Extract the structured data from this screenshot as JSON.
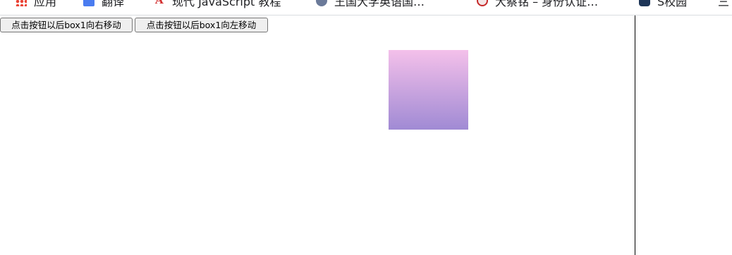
{
  "bookmarks": [
    {
      "label": "应用",
      "icon": "apps-grid-icon"
    },
    {
      "label": "翻译",
      "icon": "translate-icon"
    },
    {
      "label": "现代 JavaScript 教程",
      "icon": "javascript-tutorial-icon"
    },
    {
      "label": "王国大学英语国…",
      "icon": "university-icon"
    },
    {
      "label": "大蔡铭 – 身份认证…",
      "icon": "identity-icon"
    },
    {
      "label": "S校园",
      "icon": "s-campus-icon"
    },
    {
      "label": "三",
      "icon": ""
    }
  ],
  "buttons": {
    "move_right_label": "点击按钮以后box1向右移动",
    "move_left_label": "点击按钮以后box1向左移动"
  },
  "box1": {
    "gradient_top": "#f4c0ea",
    "gradient_bottom": "#a08ad4"
  }
}
